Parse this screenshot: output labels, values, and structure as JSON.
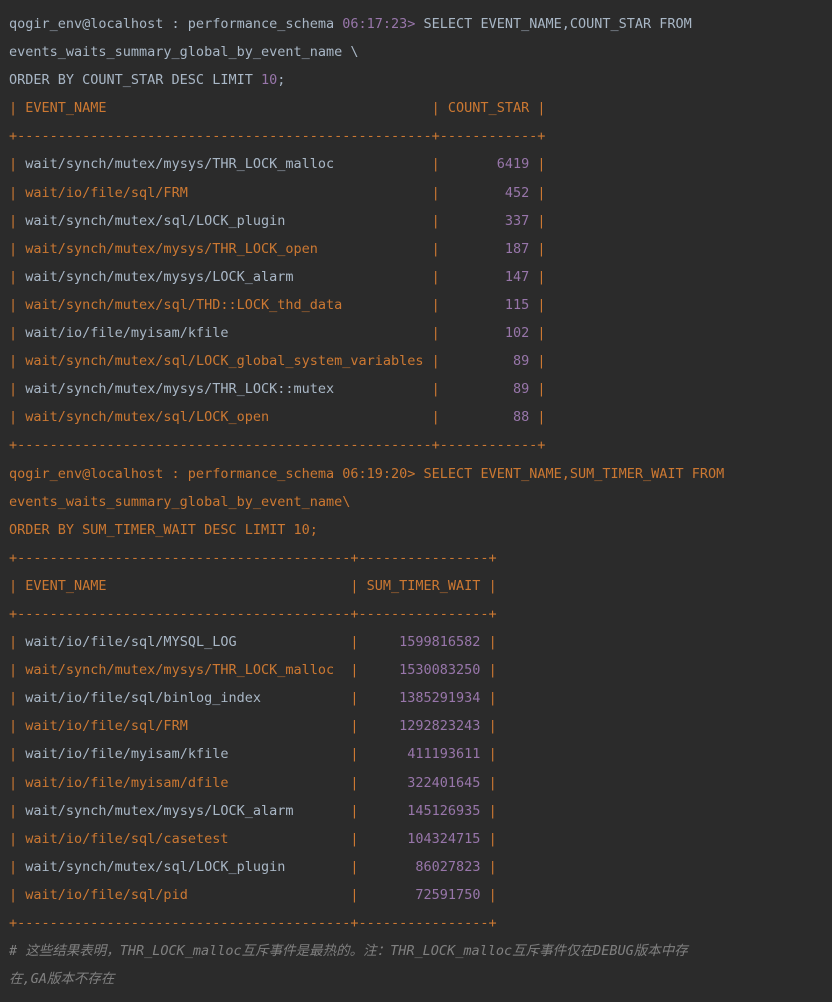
{
  "query1": {
    "prompt": "qogir_env@localhost : performance_schema",
    "time": "06:17:23>",
    "sql_line1": "SELECT EVENT_NAME,COUNT_STAR FROM",
    "sql_line2": "events_waits_summary_global_by_event_name \\",
    "sql_line3_a": "ORDER BY COUNT_STAR DESC LIMIT",
    "sql_line3_b": "10",
    "sql_line3_c": ";"
  },
  "table1": {
    "col1": "EVENT_NAME",
    "col2": "COUNT_STAR",
    "rows": [
      {
        "name": "wait/synch/mutex/mysys/THR_LOCK_malloc",
        "value": "6419"
      },
      {
        "name": "wait/io/file/sql/FRM",
        "value": "452"
      },
      {
        "name": "wait/synch/mutex/sql/LOCK_plugin",
        "value": "337"
      },
      {
        "name": "wait/synch/mutex/mysys/THR_LOCK_open",
        "value": "187"
      },
      {
        "name": "wait/synch/mutex/mysys/LOCK_alarm",
        "value": "147"
      },
      {
        "name": "wait/synch/mutex/sql/THD::LOCK_thd_data",
        "value": "115"
      },
      {
        "name": "wait/io/file/myisam/kfile",
        "value": "102"
      },
      {
        "name": "wait/synch/mutex/sql/LOCK_global_system_variables",
        "value": "89"
      },
      {
        "name": "wait/synch/mutex/mysys/THR_LOCK::mutex",
        "value": "89"
      },
      {
        "name": "wait/synch/mutex/sql/LOCK_open",
        "value": "88"
      }
    ]
  },
  "query2": {
    "prompt": "qogir_env@localhost : performance_schema",
    "time": "06:19:20>",
    "sql_line1": "SELECT EVENT_NAME,SUM_TIMER_WAIT FROM",
    "sql_line2": "events_waits_summary_global_by_event_name\\",
    "sql_line3": "ORDER BY SUM_TIMER_WAIT DESC LIMIT 10;"
  },
  "table2": {
    "col1": "EVENT_NAME",
    "col2": "SUM_TIMER_WAIT",
    "rows": [
      {
        "name": "wait/io/file/sql/MYSQL_LOG",
        "value": "1599816582"
      },
      {
        "name": "wait/synch/mutex/mysys/THR_LOCK_malloc",
        "value": "1530083250"
      },
      {
        "name": "wait/io/file/sql/binlog_index",
        "value": "1385291934"
      },
      {
        "name": "wait/io/file/sql/FRM",
        "value": "1292823243"
      },
      {
        "name": "wait/io/file/myisam/kfile",
        "value": "411193611"
      },
      {
        "name": "wait/io/file/myisam/dfile",
        "value": "322401645"
      },
      {
        "name": "wait/synch/mutex/mysys/LOCK_alarm",
        "value": "145126935"
      },
      {
        "name": "wait/io/file/sql/casetest",
        "value": "104324715"
      },
      {
        "name": "wait/synch/mutex/sql/LOCK_plugin",
        "value": "86027823"
      },
      {
        "name": "wait/io/file/sql/pid",
        "value": "72591750"
      }
    ]
  },
  "comment": {
    "line1": "# 这些结果表明，THR_LOCK_malloc互斥事件是最热的。注：THR_LOCK_malloc互斥事件仅在DEBUG版本中存",
    "line2": "在,GA版本不存在"
  },
  "colors": {
    "background": "#2b2b2b",
    "text": "#a9b7c6",
    "accent_orange": "#cc7832",
    "accent_purple": "#9876aa",
    "comment": "#808080"
  }
}
